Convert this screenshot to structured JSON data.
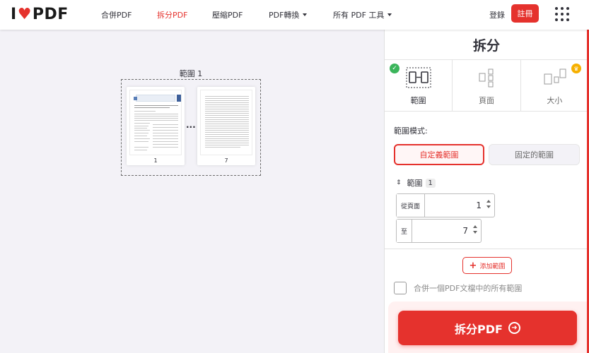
{
  "nav": {
    "logo_left": "I",
    "logo_right": "PDF",
    "items": [
      {
        "label": "合併PDF",
        "active": false
      },
      {
        "label": "拆分PDF",
        "active": true
      },
      {
        "label": "壓縮PDF",
        "active": false
      },
      {
        "label": "PDF轉換",
        "active": false,
        "dropdown": true
      },
      {
        "label": "所有 PDF 工具",
        "active": false,
        "dropdown": true
      }
    ],
    "login": "登錄",
    "signup": "註冊",
    "apps_icon": "grid-icon"
  },
  "workspace": {
    "range_label": "範圍 1",
    "pages": [
      {
        "number": "1"
      },
      {
        "number": "7"
      }
    ],
    "ellipsis": "..."
  },
  "sidebar": {
    "title": "拆分",
    "modes": [
      {
        "label": "範圍",
        "icon": "range-split-icon",
        "selected": true
      },
      {
        "label": "頁面",
        "icon": "pages-split-icon",
        "selected": false
      },
      {
        "label": "大小",
        "icon": "size-split-icon",
        "selected": false,
        "premium": true
      }
    ],
    "range_mode_label": "範圍模式:",
    "range_options": {
      "custom": "自定義範圍",
      "fixed": "固定的範圍"
    },
    "range_header": {
      "label": "範圍",
      "number": "1"
    },
    "from": {
      "label": "從頁面",
      "value": "1"
    },
    "to": {
      "label": "至",
      "value": "7"
    },
    "add_range": "添加範圍",
    "merge_checkbox_label": "合併一個PDF文檔中的所有範圍",
    "split_button": "拆分PDF"
  },
  "colors": {
    "accent": "#e5322d",
    "success": "#3bb55b",
    "premium": "#f6b000",
    "background": "#f3f2f7"
  }
}
